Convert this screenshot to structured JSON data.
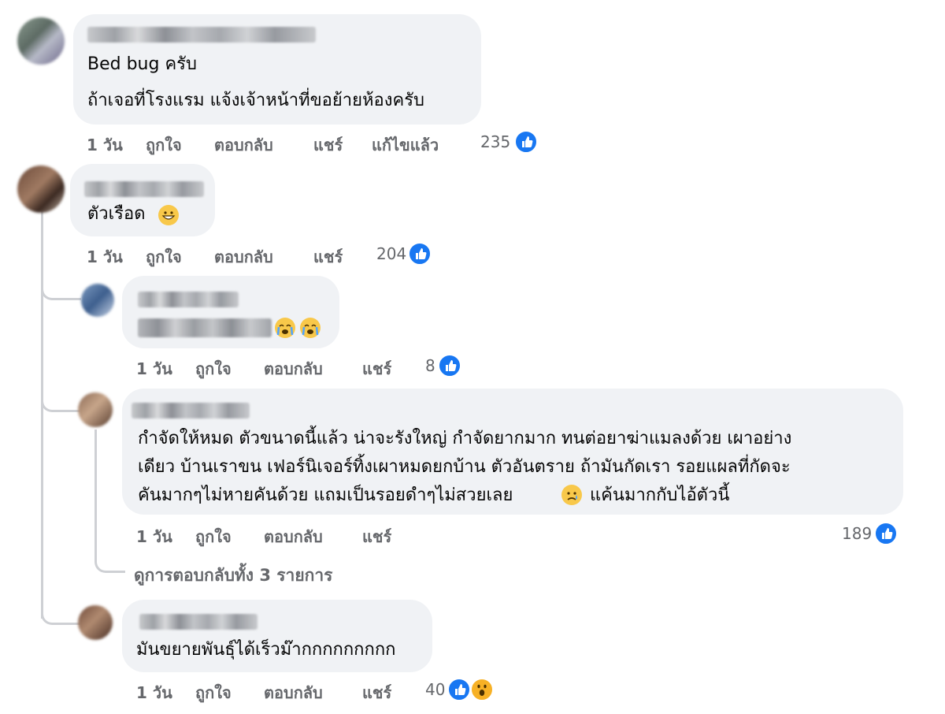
{
  "comments": [
    {
      "id": "c1",
      "lines": [
        "Bed bug ครับ",
        "ถ้าเจอที่โรงแรม แจ้งเจ้าหน้าที่ขอย้ายห้องครับ"
      ],
      "time": "1 วัน",
      "like": "ถูกใจ",
      "reply": "ตอบกลับ",
      "share": "แชร์",
      "edited": "แก้ไขแล้ว",
      "reactions": "235",
      "reaction_icons": [
        "like-icon"
      ]
    },
    {
      "id": "c2",
      "lines": [
        "ตัวเรือด"
      ],
      "emoji_after": "grinning-sweat-emoji",
      "time": "1 วัน",
      "like": "ถูกใจ",
      "reply": "ตอบกลับ",
      "share": "แชร์",
      "reactions": "204",
      "reaction_icons": [
        "like-icon"
      ]
    },
    {
      "id": "c3",
      "blurred_text": true,
      "emojis": [
        "crying-emoji",
        "crying-emoji"
      ],
      "time": "1 วัน",
      "like": "ถูกใจ",
      "reply": "ตอบกลับ",
      "share": "แชร์",
      "reactions": "8",
      "reaction_icons": [
        "like-icon"
      ]
    },
    {
      "id": "c4",
      "lines": [
        "กำจัดให้หมด ตัวขนาดนี้แล้ว น่าจะรังใหญ่ กำจัดยากมาก ทนต่อยาฆ่าแมลงด้วย เผาอย่าง",
        "เดียว บ้านเราขน เฟอร์นิเจอร์ทิ้งเผาหมดยกบ้าน ตัวอันตราย ถ้ามันกัดเรา รอยแผลที่กัดจะ",
        "คันมากๆไม่หายคันด้วย แถมเป็นรอยดำๆไม่สวยเลย",
        "แค้นมากกับไอ้ตัวนี้"
      ],
      "inline_emoji": "sad-emoji",
      "time": "1 วัน",
      "like": "ถูกใจ",
      "reply": "ตอบกลับ",
      "share": "แชร์",
      "reactions": "189",
      "reaction_icons": [
        "like-icon"
      ]
    },
    {
      "id": "c5",
      "lines": [
        "มันขยายพันธุ์ได้เร็วม๊ากกกกกกกกก"
      ],
      "time": "1 วัน",
      "like": "ถูกใจ",
      "reply": "ตอบกลับ",
      "share": "แชร์",
      "reactions": "40",
      "reaction_icons": [
        "like-icon",
        "wow-icon"
      ]
    }
  ],
  "view_replies": "ดูการตอบกลับทั้ง 3 รายการ",
  "colors": {
    "bubble": "#f0f2f5",
    "muted": "#65676b",
    "like_blue": "#1877f2",
    "thread_line": "#ced0d4"
  }
}
